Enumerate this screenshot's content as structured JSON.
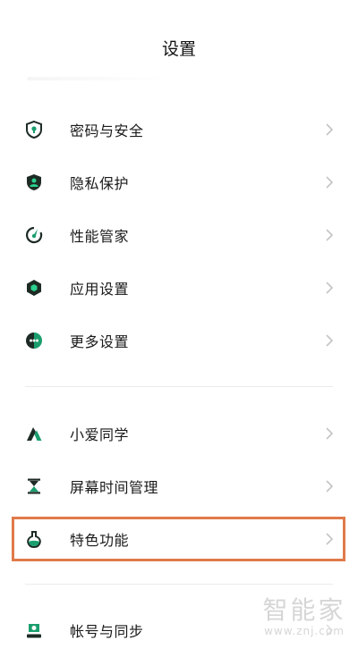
{
  "header": {
    "title": "设置"
  },
  "settings": {
    "group1": [
      {
        "label": "密码与安全",
        "icon": "shield-lock-icon"
      },
      {
        "label": "隐私保护",
        "icon": "privacy-shield-icon"
      },
      {
        "label": "性能管家",
        "icon": "performance-dial-icon"
      },
      {
        "label": "应用设置",
        "icon": "hexagon-settings-icon"
      },
      {
        "label": "更多设置",
        "icon": "more-dots-icon"
      }
    ],
    "group2": [
      {
        "label": "小爱同学",
        "icon": "xiaoai-icon"
      },
      {
        "label": "屏幕时间管理",
        "icon": "hourglass-icon"
      },
      {
        "label": "特色功能",
        "icon": "flask-icon"
      }
    ],
    "group3": [
      {
        "label": "帐号与同步",
        "icon": "account-icon"
      }
    ]
  },
  "watermark": {
    "big": "智能家",
    "small": "www.znj.com"
  },
  "colors": {
    "accent": "#1a9e6e",
    "dark": "#1d2b24",
    "highlight": "#e07a4a"
  }
}
